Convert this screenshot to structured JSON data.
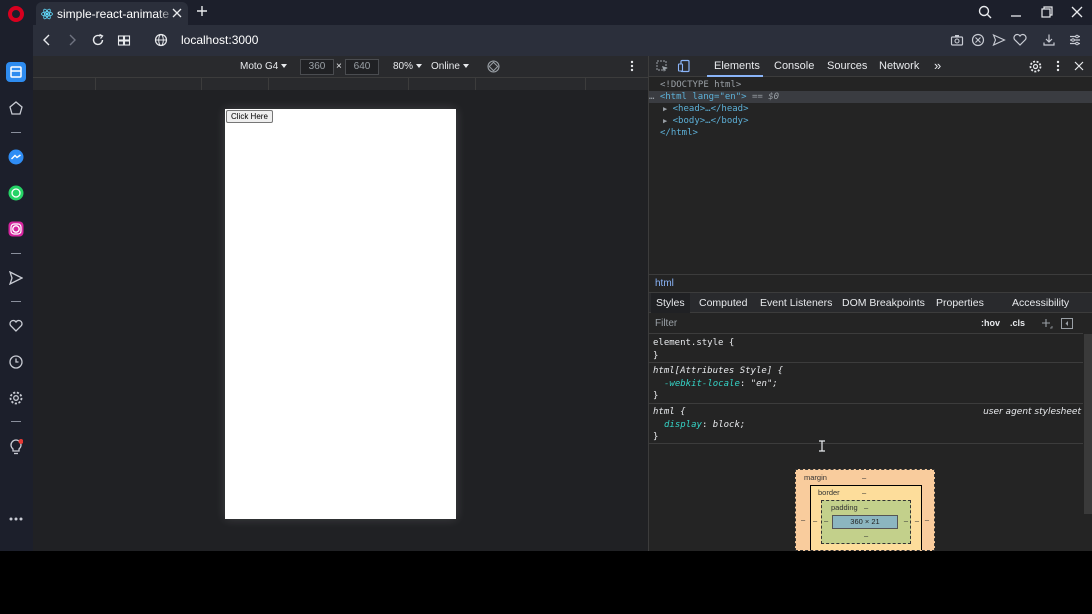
{
  "browser": {
    "tab_title": "simple-react-animate",
    "url": "localhost:3000"
  },
  "device_toolbar": {
    "device": "Moto G4",
    "width": "360",
    "times": "×",
    "height": "640",
    "zoom": "80%",
    "throttle": "Online"
  },
  "page": {
    "button_label": "Click Here"
  },
  "devtools": {
    "tabs": [
      "Elements",
      "Console",
      "Sources",
      "Network"
    ],
    "more": "»",
    "dom": {
      "doctype": "<!DOCTYPE html>",
      "html_open": "<html lang=\"en\">",
      "html_prefix": "…",
      "html_suffix": "== $0",
      "head": "<head>…</head>",
      "body": "<body>…</body>",
      "html_close": "</html>"
    },
    "breadcrumb": "html",
    "style_tabs": [
      "Styles",
      "Computed",
      "Event Listeners",
      "DOM Breakpoints",
      "Properties",
      "Accessibility"
    ],
    "filter_placeholder": "Filter",
    "hov": ":hov",
    "cls": ".cls",
    "rules": {
      "r1_selector": "element.style {",
      "r1_close": "}",
      "r2_selector": "html[Attributes Style] {",
      "r2_prop": "-webkit-locale",
      "r2_val": "\"en\";",
      "r2_close": "}",
      "r3_selector": "html {",
      "r3_source": "user agent stylesheet",
      "r3_prop": "display",
      "r3_val": "block;",
      "r3_close": "}"
    },
    "box_model": {
      "margin_label": "margin",
      "border_label": "border",
      "padding_label": "padding",
      "dash": "–",
      "content_size": "360 × 21"
    }
  },
  "colors": {
    "opera_red": "#d7001f",
    "accent_blue": "#8ab4f8",
    "sidebar_active": "#2e8cf0"
  }
}
